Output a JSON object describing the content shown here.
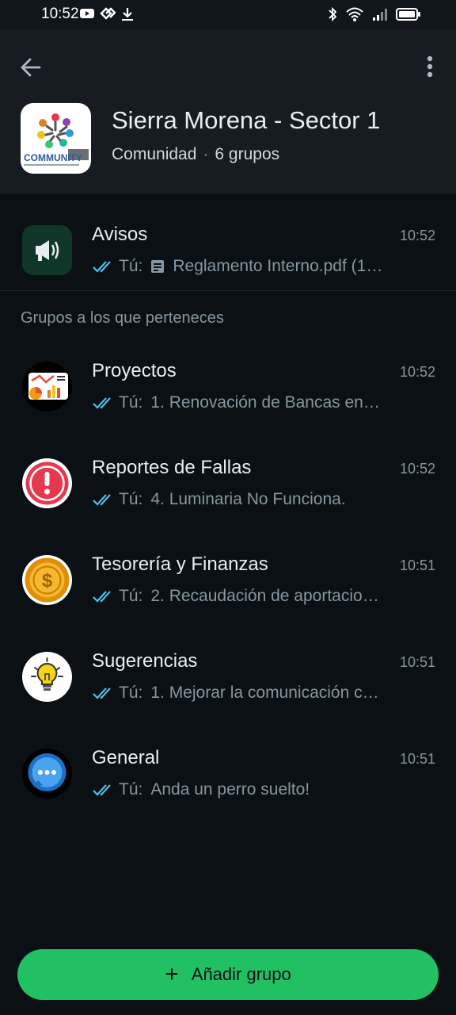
{
  "status_bar": {
    "time": "10:52"
  },
  "community": {
    "name": "Sierra Morena - Sector 1",
    "type": "Comunidad",
    "groups_count": "6 grupos",
    "logo_text": "COMMUNITY"
  },
  "announcements": {
    "title": "Avisos",
    "time": "10:52",
    "sender": "Tú:",
    "preview": "Reglamento Interno.pdf (1…"
  },
  "section_label": "Grupos a los que perteneces",
  "groups": [
    {
      "title": "Proyectos",
      "time": "10:52",
      "sender": "Tú:",
      "preview": "1. Renovación de Bancas en…",
      "icon": "chart-icon"
    },
    {
      "title": "Reportes de Fallas",
      "time": "10:52",
      "sender": "Tú:",
      "preview": "4.  Luminaria No Funciona.",
      "icon": "alert-icon"
    },
    {
      "title": "Tesorería y Finanzas",
      "time": "10:51",
      "sender": "Tú:",
      "preview": "2.  Recaudación de aportacio…",
      "icon": "coin-icon"
    },
    {
      "title": "Sugerencias",
      "time": "10:51",
      "sender": "Tú:",
      "preview": "1. Mejorar la comunicación c…",
      "icon": "lightbulb-icon"
    },
    {
      "title": "General",
      "time": "10:51",
      "sender": "Tú:",
      "preview": "Anda un perro suelto!",
      "icon": "chat-bubble-icon"
    }
  ],
  "add_group_label": "Añadir grupo",
  "colors": {
    "accent": "#21c063",
    "tick": "#53bdeb",
    "background": "#0b1014",
    "header": "#161c21"
  }
}
